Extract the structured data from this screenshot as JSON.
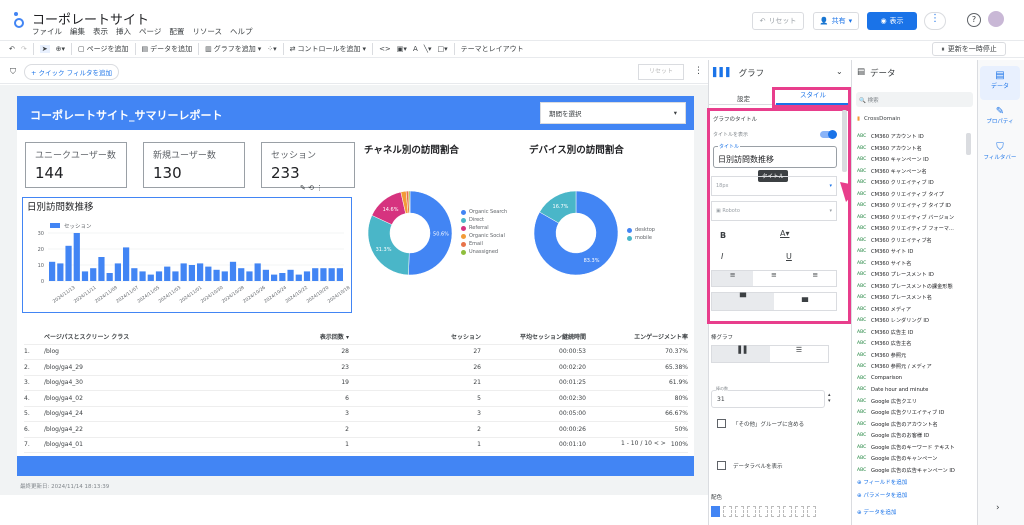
{
  "app": {
    "title": "コーポレートサイト",
    "menu": [
      "ファイル",
      "編集",
      "表示",
      "挿入",
      "ページ",
      "配置",
      "リソース",
      "ヘルプ"
    ],
    "reset": "リセット",
    "share": "共有",
    "view": "表示"
  },
  "toolbar": {
    "add_page": "ページを追加",
    "add_data": "データを追加",
    "add_chart": "グラフを追加",
    "add_control": "コントロールを追加",
    "theme": "テーマとレイアウト",
    "pause": "更新を一時停止"
  },
  "filter": {
    "quick": "+ クイック フィルタを追加",
    "reset": "リセット"
  },
  "report": {
    "title": "コーポレートサイト_サマリーレポート",
    "period": "期間を選択",
    "scorecards": [
      {
        "label": "ユニークユーザー数",
        "value": "144"
      },
      {
        "label": "新規ユーザー数",
        "value": "130"
      },
      {
        "label": "セッション",
        "value": "233"
      }
    ],
    "trend_title": "日別訪問数推移",
    "channel_title": "チャネル別の訪問割合",
    "device_title": "デバイス別の訪問割合",
    "updated": "最終更新日: 2024/11/14 18:13:39"
  },
  "chart_data": [
    {
      "type": "bar",
      "title": "日別訪問数推移",
      "series": [
        {
          "name": "セッション",
          "values": [
            12,
            11,
            22,
            30,
            6,
            8,
            15,
            5,
            11,
            21,
            8,
            6,
            4,
            6,
            9,
            6,
            11,
            10,
            11,
            9,
            7,
            6,
            12,
            8,
            6,
            11,
            7,
            4,
            5,
            7,
            4,
            6,
            8,
            8,
            8,
            8
          ]
        }
      ],
      "categories": [
        "2024/11/13",
        "2024/11/11",
        "2024/11/09",
        "2024/11/07",
        "2024/11/05",
        "2024/11/03",
        "2024/11/01",
        "2024/10/30",
        "2024/10/28",
        "2024/10/26",
        "2024/10/24",
        "2024/10/22",
        "2024/10/20",
        "2024/10/18"
      ],
      "ylim": [
        0,
        30
      ]
    },
    {
      "type": "pie",
      "title": "チャネル別の訪問割合",
      "categories": [
        "Organic Search",
        "Direct",
        "Referral",
        "Organic Social",
        "Email",
        "Unassigned"
      ],
      "values": [
        50.6,
        31.3,
        14.6,
        2.0,
        1.0,
        0.5
      ],
      "labels": [
        "50.6%",
        "31.3%",
        "14.6%"
      ],
      "colors": [
        "#4285f4",
        "#4ab6c8",
        "#d6337f",
        "#f29b38",
        "#e8734a",
        "#8fbe3d"
      ]
    },
    {
      "type": "pie",
      "title": "デバイス別の訪問割合",
      "categories": [
        "desktop",
        "mobile"
      ],
      "values": [
        83.3,
        16.7
      ],
      "labels": [
        "83.3%",
        "16.7%"
      ],
      "colors": [
        "#4285f4",
        "#4ab6c8"
      ]
    }
  ],
  "table": {
    "headers": [
      "ページパスとスクリーン クラス",
      "表示回数 ▾",
      "セッション",
      "平均セッション継続時間",
      "エンゲージメント率"
    ],
    "rows": [
      [
        "1.",
        "/blog",
        "28",
        "27",
        "00:00:53",
        "70.37%"
      ],
      [
        "2.",
        "/blog/ga4_29",
        "23",
        "26",
        "00:02:20",
        "65.38%"
      ],
      [
        "3.",
        "/blog/ga4_30",
        "19",
        "21",
        "00:01:25",
        "61.9%"
      ],
      [
        "4.",
        "/blog/ga4_02",
        "6",
        "5",
        "00:02:30",
        "80%"
      ],
      [
        "5.",
        "/blog/ga4_24",
        "3",
        "3",
        "00:05:00",
        "66.67%"
      ],
      [
        "6.",
        "/blog/ga4_22",
        "2",
        "2",
        "00:00:26",
        "50%"
      ],
      [
        "7.",
        "/blog/ga4_01",
        "1",
        "1",
        "00:01:10",
        "100%"
      ]
    ],
    "pager": "1 - 10 / 10"
  },
  "chart_panel": {
    "title": "グラフ",
    "tab_setup": "設定",
    "tab_style": "スタイル",
    "section": "グラフのタイトル",
    "show_title": "タイトルを表示",
    "title_label": "タイトル",
    "title_value": "日別訪問数推移",
    "tooltip": "タイトル",
    "font_size": "18px",
    "font": "Roboto",
    "axis_section": "棒グラフ",
    "bars_label": "棒の数",
    "bars_value": "31",
    "others": "「その他」グループに含める",
    "data_labels": "データラベルを表示",
    "color": "配色"
  },
  "data_panel": {
    "title": "データ",
    "search": "検索",
    "source": "CrossDomain",
    "fields": [
      "CM360 アカウント ID",
      "CM360 アカウント名",
      "CM360 キャンペーン ID",
      "CM360 キャンペーン名",
      "CM360 クリエイティブ ID",
      "CM360 クリエイティブ タイプ",
      "CM360 クリエイティブ タイプ ID",
      "CM360 クリエイティブ バージョン",
      "CM360 クリエイティブ フォーマ...",
      "CM360 クリエイティブ名",
      "CM360 サイト ID",
      "CM360 サイト名",
      "CM360 プレースメント ID",
      "CM360 プレースメントの課金形態",
      "CM360 プレースメント名",
      "CM360 メディア",
      "CM360 レンダリング ID",
      "CM360 広告主 ID",
      "CM360 広告主名",
      "CM360 参照元",
      "CM360 参照元 / メディア",
      "Comparison",
      "Date hour and minute",
      "Google 広告クエリ",
      "Google 広告クリエイティブ ID",
      "Google 広告のアカウント名",
      "Google 広告のお客様 ID",
      "Google 広告のキーワード テキスト",
      "Google 広告のキャンペーン",
      "Google 広告の広告キャンペーン ID"
    ],
    "add_field": "フィールドを追加",
    "add_param": "パラメータを追加",
    "add_data": "データを追加"
  },
  "rail": {
    "data": "データ",
    "properties": "プロパティ",
    "filter": "フィルタバー"
  }
}
